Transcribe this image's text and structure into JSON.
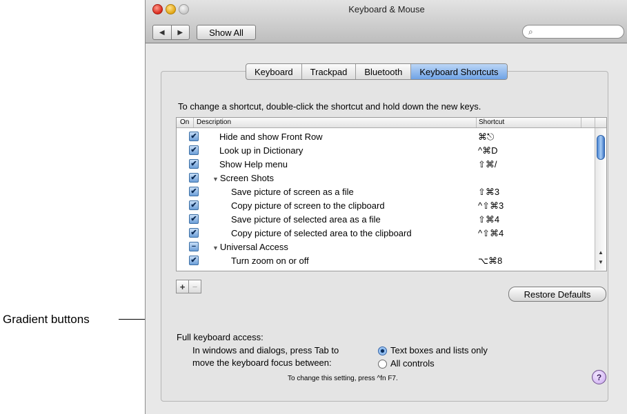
{
  "callout": {
    "label": "Gradient buttons"
  },
  "window": {
    "title": "Keyboard & Mouse",
    "back_glyph": "◀",
    "forward_glyph": "▶",
    "show_all": "Show All",
    "search_placeholder": "",
    "search_icon": "magnifier-icon"
  },
  "tabs": [
    "Keyboard",
    "Trackpad",
    "Bluetooth",
    "Keyboard Shortcuts"
  ],
  "active_tab": "Keyboard Shortcuts",
  "instruction": "To change a shortcut, double-click the shortcut and hold down the new keys.",
  "table": {
    "headers": {
      "on": "On",
      "description": "Description",
      "shortcut": "Shortcut"
    },
    "rows": [
      {
        "checked": "✔",
        "description": "Hide and show Front Row",
        "shortcut": "⌘⎋"
      },
      {
        "checked": "✔",
        "description": "Look up in Dictionary",
        "shortcut": "^⌘D"
      },
      {
        "checked": "✔",
        "description": "Show Help menu",
        "shortcut": "⇧⌘/"
      },
      {
        "checked": "✔",
        "description": "Screen Shots",
        "shortcut": "",
        "group": "▼"
      },
      {
        "checked": "✔",
        "description": "Save picture of screen as a file",
        "shortcut": "⇧⌘3"
      },
      {
        "checked": "✔",
        "description": "Copy picture of screen to the clipboard",
        "shortcut": "^⇧⌘3"
      },
      {
        "checked": "✔",
        "description": "Save picture of selected area as a file",
        "shortcut": "⇧⌘4"
      },
      {
        "checked": "✔",
        "description": "Copy picture of selected area to the clipboard",
        "shortcut": "^⇧⌘4"
      },
      {
        "checked": "−",
        "description": "Universal Access",
        "shortcut": "",
        "group": "▼"
      },
      {
        "checked": "✔",
        "description": "Turn zoom on or off",
        "shortcut": "⌥⌘8"
      }
    ]
  },
  "gradient_buttons": {
    "add": "+",
    "remove": "−"
  },
  "restore_defaults": "Restore Defaults",
  "keyboard_access": {
    "title": "Full keyboard access:",
    "line1": "In windows and dialogs, press Tab to",
    "line2": "move the keyboard focus between:",
    "options": [
      "Text boxes and lists only",
      "All controls"
    ],
    "selected": "Text boxes and lists only",
    "note": "To change this setting, press ^fn F7.",
    "help": "?"
  },
  "colors": {
    "selected_tab": "#6fa3e6",
    "checkbox": "#6d9fd8"
  }
}
